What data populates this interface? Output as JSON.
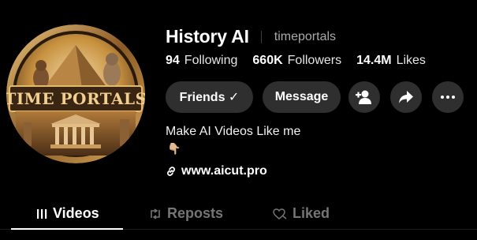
{
  "profile": {
    "display_name": "History AI",
    "handle": "timeportals",
    "avatar_text": "TIME PORTALS"
  },
  "stats": [
    {
      "value": "94",
      "label": "Following"
    },
    {
      "value": "660K",
      "label": "Followers"
    },
    {
      "value": "14.4M",
      "label": "Likes"
    }
  ],
  "actions": {
    "friends_label": "Friends ✓",
    "message_label": "Message",
    "icons": [
      "add-user-icon",
      "share-icon",
      "more-icon"
    ]
  },
  "bio": {
    "text": "Make AI Videos Like me",
    "emoji": "👇🏼"
  },
  "link": {
    "text": "www.aicut.pro",
    "icon": "link-icon"
  },
  "tabs": [
    {
      "label": "Videos",
      "icon": "grid-icon",
      "active": true
    },
    {
      "label": "Reposts",
      "icon": "repost-icon",
      "active": false
    },
    {
      "label": "Liked",
      "icon": "liked-heart-icon",
      "active": false
    }
  ],
  "colors": {
    "background": "#000000",
    "button_bg": "#2f2f2f",
    "muted_text": "#a9a9a9",
    "inactive_tab": "#757575",
    "avatar_gold": "#c8923f"
  }
}
